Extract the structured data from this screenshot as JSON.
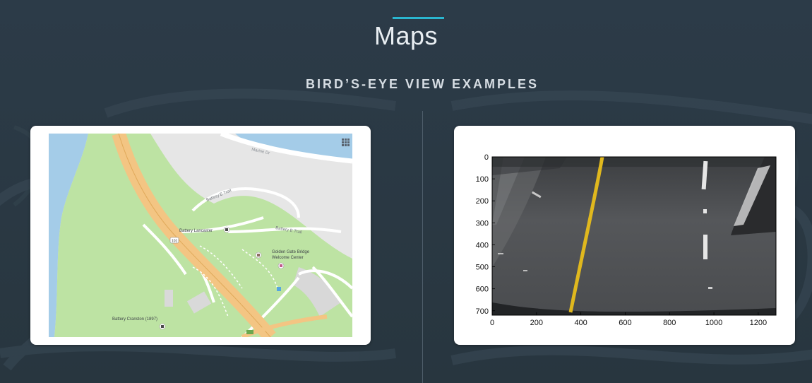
{
  "slide": {
    "title": "Maps",
    "subtitle": "BIRD’S-EYE VIEW EXAMPLES"
  },
  "map": {
    "labels": {
      "marine_dr": "Marine Dr",
      "battery_e_trail_1": "Battery E Trail",
      "battery_e_trail_2": "Battery E Trail",
      "battery_lancaster": "Battery Lancaster",
      "golden_gate_line1": "Golden Gate Bridge",
      "golden_gate_line2": "Welcome Center",
      "battery_cranston": "Battery Cranston (1897)",
      "route_shield": "101"
    },
    "icons": [
      "grid-menu-icon",
      "landmark-icon",
      "landmark-icon",
      "parking-icon",
      "highway-shield-icon"
    ],
    "colors": {
      "water": "#a4cce8",
      "park": "#bde3a3",
      "land": "#e6e6e6",
      "highway": "#f3c583",
      "road": "#ffffff"
    }
  },
  "plot": {
    "x_ticks": [
      "0",
      "200",
      "400",
      "600",
      "800",
      "1000",
      "1200"
    ],
    "y_ticks": [
      "0",
      "100",
      "200",
      "300",
      "400",
      "500",
      "600",
      "700"
    ],
    "xlim": [
      0,
      1280
    ],
    "ylim": [
      0,
      720
    ],
    "colors": {
      "lane_yellow": "#e0b81e",
      "road": "#55575a"
    }
  }
}
